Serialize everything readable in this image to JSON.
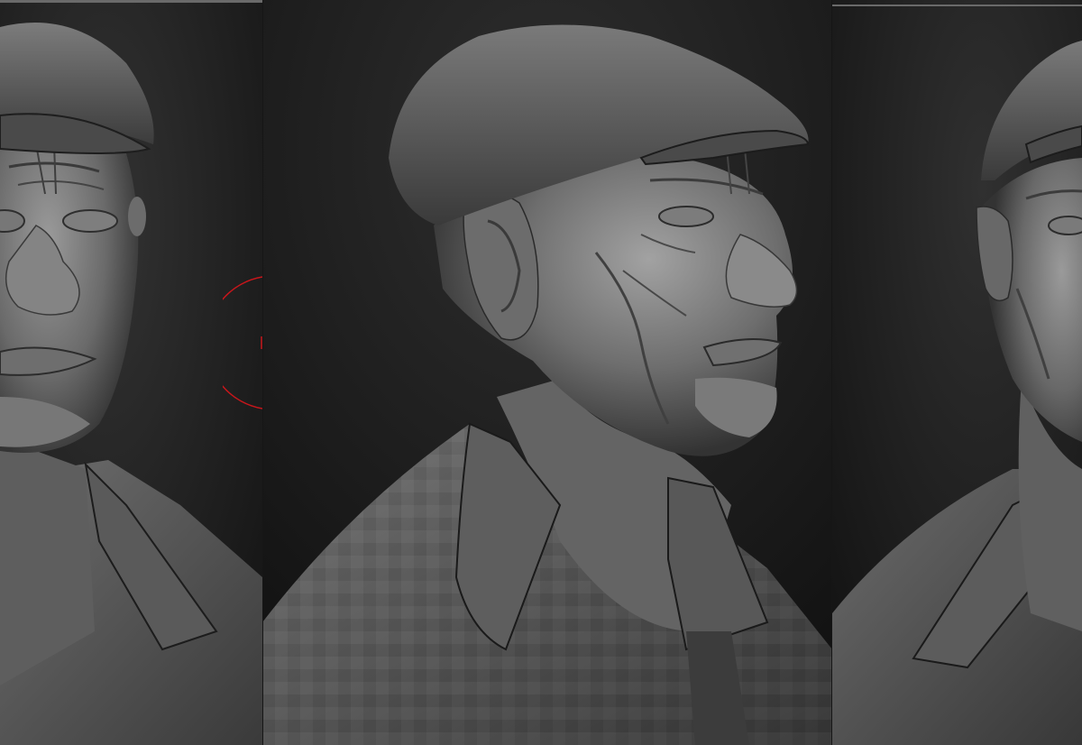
{
  "scene": {
    "subject": "sculpt-viewport",
    "panels": [
      {
        "id": "left",
        "view": "front"
      },
      {
        "id": "center",
        "view": "three-quarter"
      },
      {
        "id": "right",
        "view": "three-quarter-cropped"
      }
    ],
    "colors": {
      "background_top": "#2f2f2f",
      "background_bottom": "#141414",
      "clay_light": "#8e8e8e",
      "clay_mid": "#5c5c5c",
      "clay_dark": "#2a2a2a",
      "brush_ring": "#c8161b"
    },
    "icons": [
      "brush-cursor-icon"
    ]
  }
}
